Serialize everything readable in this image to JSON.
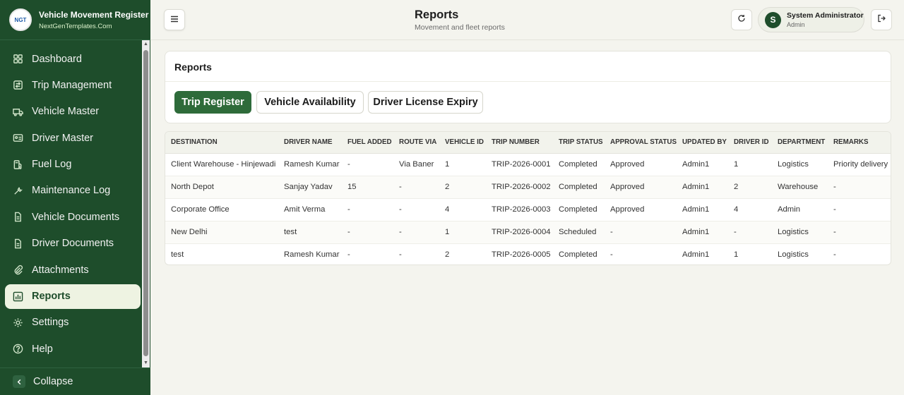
{
  "brand": {
    "logo_text": "NGT",
    "title": "Vehicle Movement Register",
    "subtitle": "NextGenTemplates.Com"
  },
  "nav": {
    "items": [
      {
        "label": "Dashboard",
        "icon": "dashboard-icon",
        "active": false
      },
      {
        "label": "Trip Management",
        "icon": "route-icon",
        "active": false
      },
      {
        "label": "Vehicle Master",
        "icon": "truck-icon",
        "active": false
      },
      {
        "label": "Driver Master",
        "icon": "id-card-icon",
        "active": false
      },
      {
        "label": "Fuel Log",
        "icon": "fuel-icon",
        "active": false
      },
      {
        "label": "Maintenance Log",
        "icon": "wrench-icon",
        "active": false
      },
      {
        "label": "Vehicle Documents",
        "icon": "document-icon",
        "active": false
      },
      {
        "label": "Driver Documents",
        "icon": "document-icon",
        "active": false
      },
      {
        "label": "Attachments",
        "icon": "paperclip-icon",
        "active": false
      },
      {
        "label": "Reports",
        "icon": "bar-chart-icon",
        "active": true
      },
      {
        "label": "Settings",
        "icon": "gear-icon",
        "active": false
      },
      {
        "label": "Help",
        "icon": "help-icon",
        "active": false
      }
    ],
    "collapse_label": "Collapse"
  },
  "header": {
    "title": "Reports",
    "subtitle": "Movement and fleet reports",
    "user_initial": "S",
    "user_name": "System Administrator",
    "user_role": "Admin"
  },
  "report": {
    "title": "Reports",
    "tabs": [
      {
        "label": "Trip Register",
        "active": true
      },
      {
        "label": "Vehicle Availability",
        "active": false
      },
      {
        "label": "Driver License Expiry",
        "active": false
      }
    ]
  },
  "table": {
    "columns": [
      "DESTINATION",
      "DRIVER NAME",
      "FUEL ADDED",
      "ROUTE VIA",
      "VEHICLE ID",
      "TRIP NUMBER",
      "TRIP STATUS",
      "APPROVAL STATUS",
      "UPDATED BY",
      "DRIVER ID",
      "DEPARTMENT",
      "REMARKS"
    ],
    "rows": [
      [
        "Client Warehouse - Hinjewadi",
        "Ramesh Kumar",
        "-",
        "Via Baner",
        "1",
        "TRIP-2026-0001",
        "Completed",
        "Approved",
        "Admin1",
        "1",
        "Logistics",
        "Priority delivery"
      ],
      [
        "North Depot",
        "Sanjay Yadav",
        "15",
        "-",
        "2",
        "TRIP-2026-0002",
        "Completed",
        "Approved",
        "Admin1",
        "2",
        "Warehouse",
        "-"
      ],
      [
        "Corporate Office",
        "Amit Verma",
        "-",
        "-",
        "4",
        "TRIP-2026-0003",
        "Completed",
        "Approved",
        "Admin1",
        "4",
        "Admin",
        "-"
      ],
      [
        "New Delhi",
        "test",
        "-",
        "-",
        "1",
        "TRIP-2026-0004",
        "Scheduled",
        "-",
        "Admin1",
        "-",
        "Logistics",
        "-"
      ],
      [
        "test",
        "Ramesh Kumar",
        "-",
        "-",
        "2",
        "TRIP-2026-0005",
        "Completed",
        "-",
        "Admin1",
        "1",
        "Logistics",
        "-"
      ]
    ]
  },
  "colors": {
    "sidebar_bg": "#1e4d2b",
    "accent": "#2e6b3a",
    "page_bg": "#f4f4ee"
  }
}
